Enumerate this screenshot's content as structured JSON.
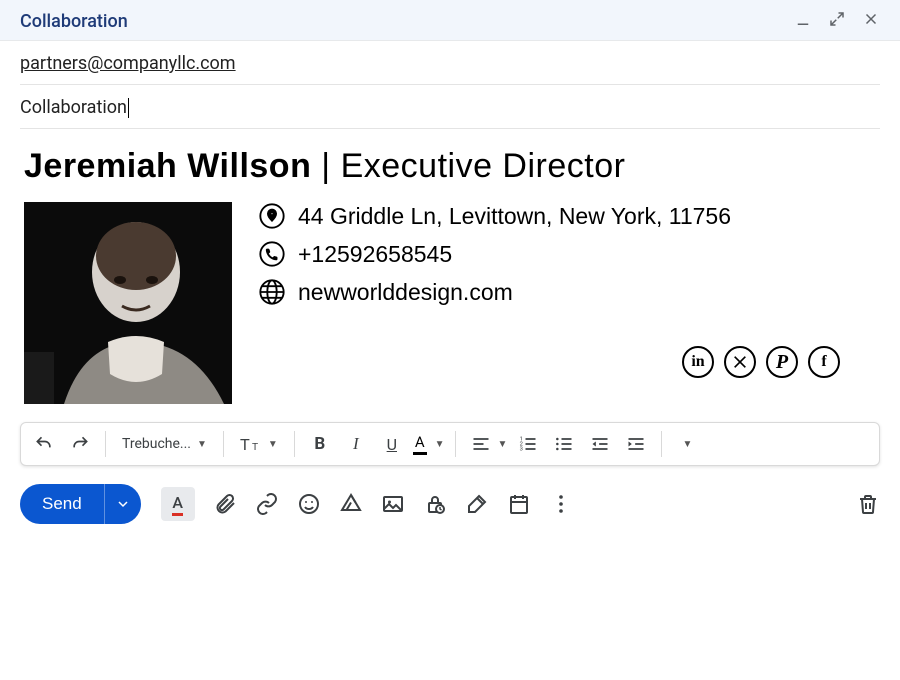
{
  "header": {
    "title": "Collaboration"
  },
  "to": {
    "value": "partners@companyllc.com"
  },
  "subject": {
    "value": "Collaboration"
  },
  "signature": {
    "name": "Jeremiah Willson",
    "separator": " | ",
    "title": "Executive Director",
    "address": "44 Griddle Ln, Levittown, New York, 11756",
    "phone": "+12592658545",
    "website": "newworlddesign.com",
    "socials": [
      "linkedin",
      "x",
      "pinterest",
      "facebook"
    ]
  },
  "toolbar": {
    "font_label": "Trebuche..."
  },
  "actions": {
    "send_label": "Send"
  }
}
